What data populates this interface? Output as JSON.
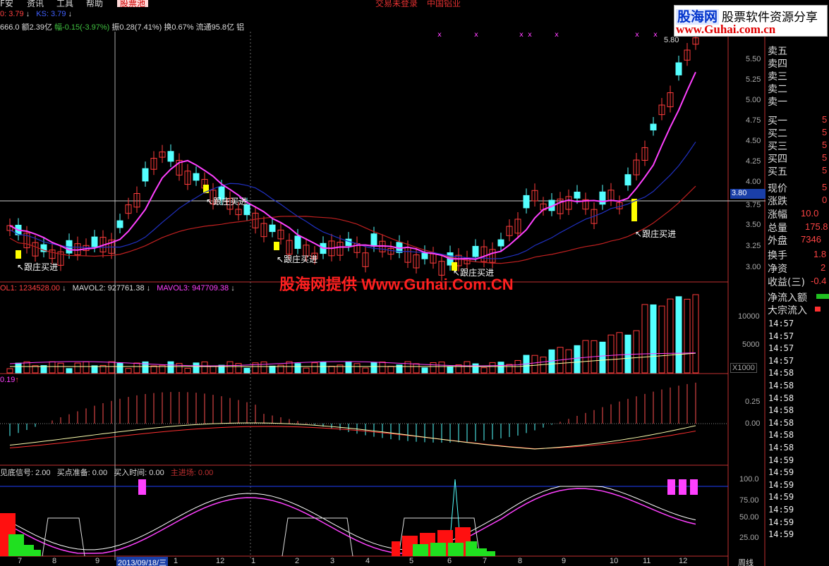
{
  "menu": {
    "items": [
      "F安",
      "资讯",
      "工具",
      "帮助"
    ],
    "active": "股票池",
    "center_items": [
      "交易未登录",
      "中国铝业"
    ]
  },
  "logo": {
    "brand": "股海网",
    "tagline": "股票软件资源分享",
    "url": "www.Guhai.com.cn"
  },
  "watermark": "股海网提供 Www.Guhai.Com.CN",
  "price_panel": {
    "indicator_header": [
      {
        "text": "0: 3.79",
        "color": "#ff4040"
      },
      {
        "text": "KS: 3.79",
        "color": "#4060ff"
      }
    ],
    "info_line": [
      {
        "text": "666.0 额2.39亿",
        "color": "#dddddd"
      },
      {
        "text": "幅-0.15(-3.97%)",
        "color": "#40c040"
      },
      {
        "text": "振0.28(7.41%) 换0.67% 流通95.8亿 铝",
        "color": "#dddddd"
      }
    ],
    "price_marker": "3.80",
    "high_label": "5.80",
    "y_ticks": [
      "5.50",
      "5.25",
      "5.00",
      "4.75",
      "4.50",
      "4.25",
      "4.00",
      "3.75",
      "3.50",
      "3.25",
      "3.00"
    ],
    "annotations": [
      "跟庄买进",
      "跟庄买进",
      "跟庄买进",
      "跟庄买进",
      "跟庄买进"
    ]
  },
  "volume_panel": {
    "header": [
      {
        "text": "OL1: 1234528.00",
        "color": "#ff4040"
      },
      {
        "text": "MAVOL2: 927761.38",
        "color": "#dddddd"
      },
      {
        "text": "MAVOL3: 947709.38",
        "color": "#ff40ff"
      }
    ],
    "y_ticks": [
      "10000",
      "5000"
    ],
    "unit": "X1000"
  },
  "macd_panel": {
    "header": "0.19",
    "y_ticks": [
      "0.25",
      "0.00"
    ]
  },
  "signal_panel": {
    "header": [
      {
        "text": "见底信号: 2.00",
        "color": "#dddddd"
      },
      {
        "text": "买点准备: 0.00",
        "color": "#dddddd"
      },
      {
        "text": "买入时间: 0.00",
        "color": "#dddddd"
      },
      {
        "text": "主进场: 0.00",
        "color": "#c03030"
      }
    ],
    "y_ticks": [
      "100.0",
      "75.00",
      "50.00",
      "25.00"
    ]
  },
  "x_axis": {
    "labels": [
      "7",
      "8",
      "9",
      "2013/09/18/三",
      "1",
      "12",
      "1",
      "2",
      "3",
      "4",
      "5",
      "6",
      "7",
      "8",
      "9",
      "10",
      "11",
      "12"
    ],
    "period": "周线"
  },
  "order_book": {
    "sell": [
      "卖五",
      "卖四",
      "卖三",
      "卖二",
      "卖一"
    ],
    "buy": [
      "买一",
      "买二",
      "买三",
      "买四",
      "买五"
    ],
    "buy_values": [
      "5",
      "5",
      "5",
      "5",
      "5"
    ]
  },
  "quote": [
    {
      "label": "现价",
      "value": "5"
    },
    {
      "label": "涨跌",
      "value": "0"
    },
    {
      "label": "涨幅",
      "value": "10.0"
    },
    {
      "label": "总量",
      "value": "175.8"
    },
    {
      "label": "外盘",
      "value": "7346"
    },
    {
      "label": "换手",
      "value": "1.8"
    },
    {
      "label": "净资",
      "value": "2"
    },
    {
      "label": "收益(三)",
      "value": "-0.4"
    }
  ],
  "flow": [
    {
      "label": "净流入额",
      "color": "#20c020"
    },
    {
      "label": "大宗流入",
      "color": "#ff3030"
    }
  ],
  "ticks": [
    "14:57",
    "14:57",
    "14:57",
    "14:57",
    "14:58",
    "14:58",
    "14:58",
    "14:58",
    "14:58",
    "14:58",
    "14:58",
    "14:59",
    "14:59",
    "14:59",
    "14:59",
    "14:59",
    "14:59",
    "14:59"
  ]
}
